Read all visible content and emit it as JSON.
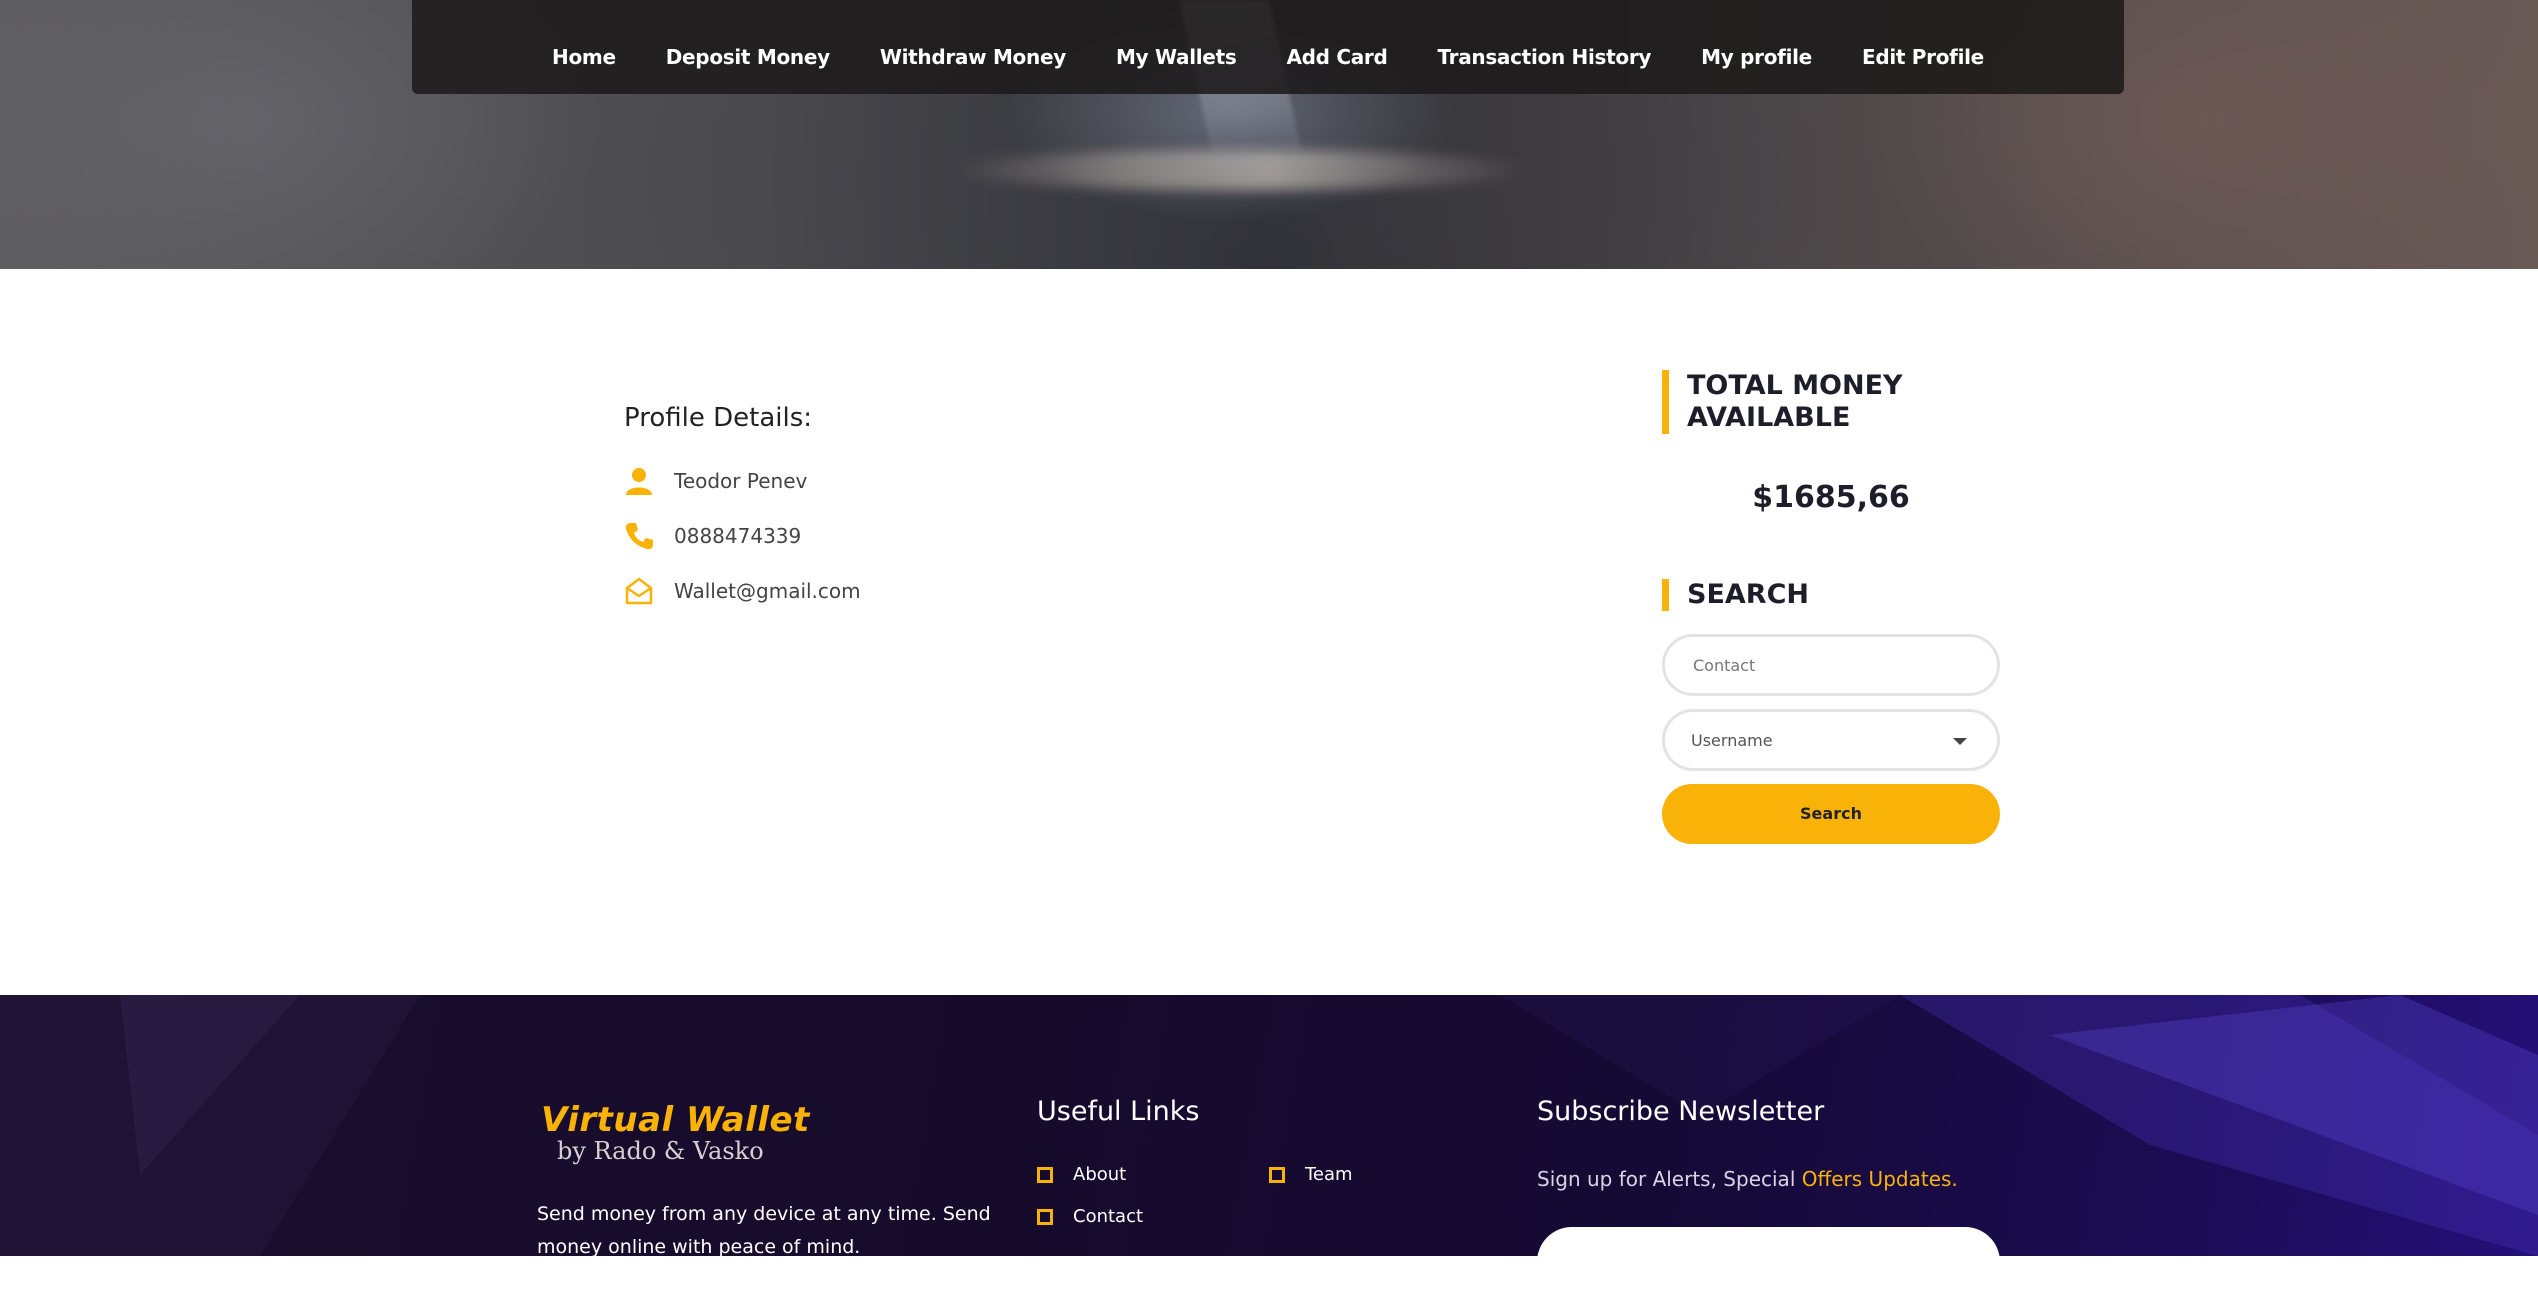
{
  "colors": {
    "accent": "#f9b208",
    "navbar_bg": "#1c1a1a",
    "footer_bg": "#170b2c",
    "heading_text": "#1e1e2a"
  },
  "nav": {
    "items": [
      "Home",
      "Deposit Money",
      "Withdraw Money",
      "My Wallets",
      "Add Card",
      "Transaction History",
      "My profile",
      "Edit Profile"
    ]
  },
  "profile": {
    "title": "Profile Details:",
    "name": "Teodor Penev",
    "phone": "0888474339",
    "email": "Wallet@gmail.com",
    "icons": {
      "name": "user-icon",
      "phone": "phone-icon",
      "email": "envelope-icon"
    }
  },
  "sidebar": {
    "total_heading_line1": "TOTAL MONEY",
    "total_heading_line2": "AVAILABLE",
    "total_amount": "$1685,66",
    "search_heading": "SEARCH",
    "contact_placeholder": "Contact",
    "username_selected": "Username",
    "search_button": "Search"
  },
  "footer": {
    "logo_main": "Virtual Wallet",
    "logo_sub": "by Rado & Vasko",
    "description": "Send money from any device at any time. Send money online with peace of mind.",
    "useful_links_heading": "Useful Links",
    "links": [
      "About",
      "Team",
      "Contact"
    ],
    "newsletter_heading": "Subscribe Newsletter",
    "newsletter_text": "Sign up for Alerts, Special ",
    "newsletter_highlight": "Offers Updates."
  }
}
